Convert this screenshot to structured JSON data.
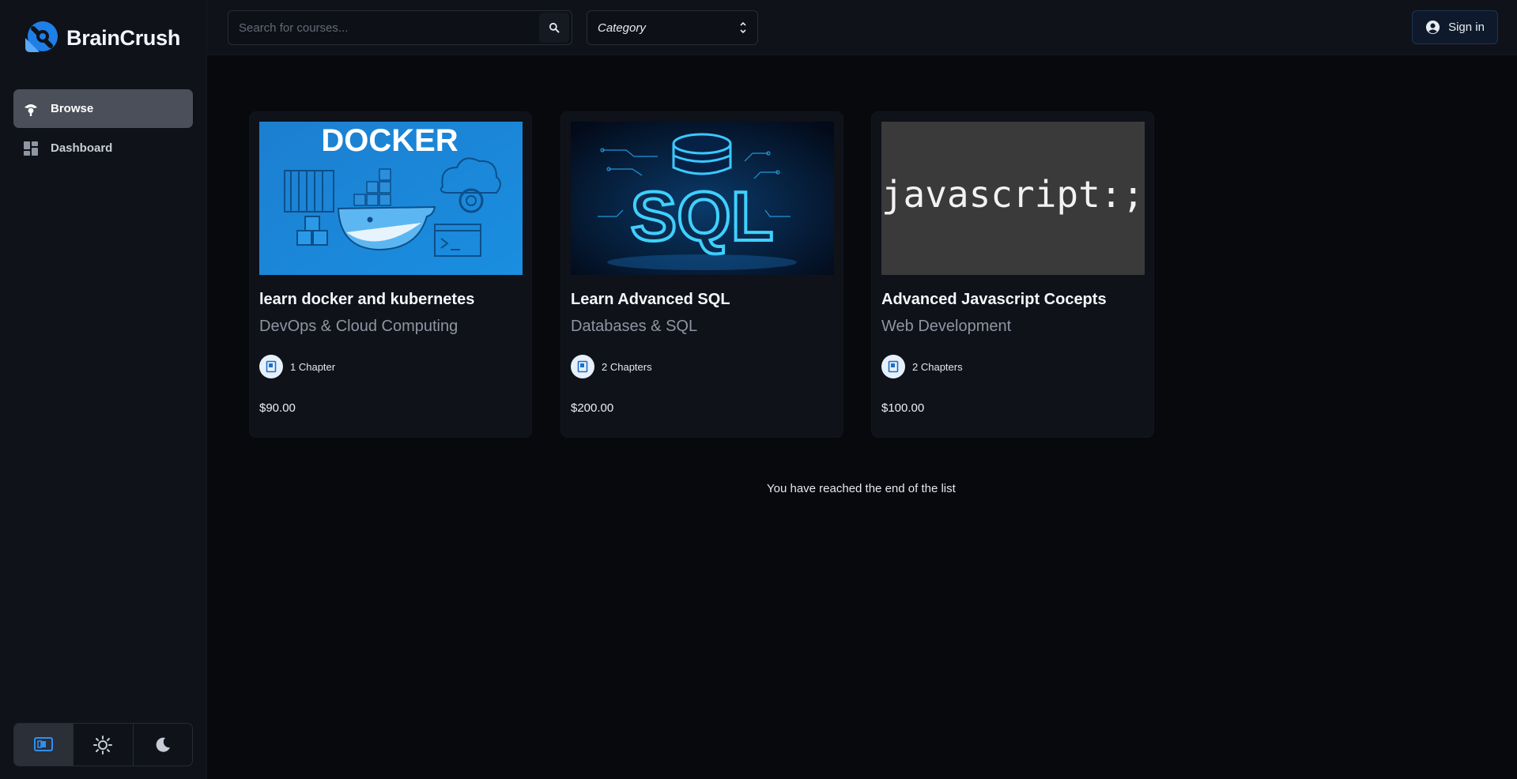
{
  "app": {
    "name": "BrainCrush"
  },
  "sidebar": {
    "items": [
      {
        "label": "Browse",
        "icon": "compass-icon",
        "active": true
      },
      {
        "label": "Dashboard",
        "icon": "dashboard-icon",
        "active": false
      }
    ],
    "theme_options": [
      {
        "name": "system-theme",
        "active": true
      },
      {
        "name": "light-theme",
        "active": false
      },
      {
        "name": "dark-theme",
        "active": false
      }
    ]
  },
  "header": {
    "search_placeholder": "Search for courses...",
    "category_label": "Category",
    "signin_label": "Sign in"
  },
  "courses": [
    {
      "title": "learn docker and kubernetes",
      "category": "DevOps & Cloud Computing",
      "chapters": "1 Chapter",
      "price": "$90.00",
      "image_text": "DOCKER"
    },
    {
      "title": "Learn Advanced SQL",
      "category": "Databases & SQL",
      "chapters": "2 Chapters",
      "price": "$200.00",
      "image_text": "SQL"
    },
    {
      "title": "Advanced Javascript Cocepts",
      "category": "Web Development",
      "chapters": "2 Chapters",
      "price": "$100.00",
      "image_text": "javascript:;"
    }
  ],
  "end_message": "You have reached the end of the list",
  "colors": {
    "accent": "#1f8ef1",
    "background": "#07090d",
    "panel": "#0f1219"
  }
}
